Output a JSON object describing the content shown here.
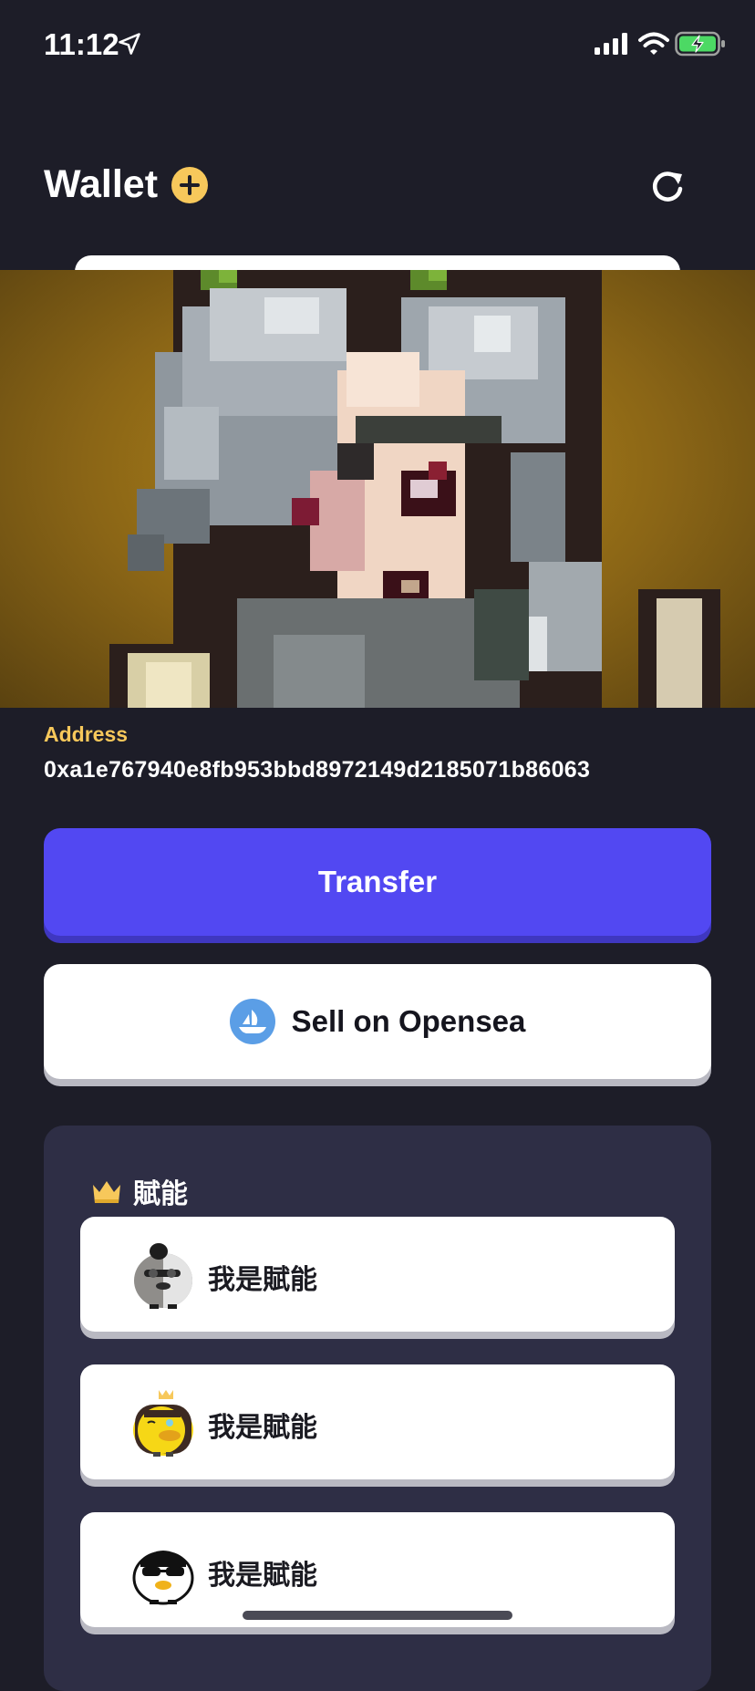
{
  "status_bar": {
    "time": "11:12",
    "icons": [
      "location-arrow-icon",
      "cellular-signal-icon",
      "wifi-icon",
      "battery-charging-icon"
    ]
  },
  "header": {
    "title": "Wallet",
    "add_icon": "plus-circle-icon",
    "refresh_icon": "refresh-icon"
  },
  "nft": {
    "image_desc": "pixel-art-character-silver-hair"
  },
  "address": {
    "label": "Address",
    "value": "0xa1e767940e8fb953bbd8972149d2185071b86063"
  },
  "actions": {
    "transfer_label": "Transfer",
    "opensea_label": "Sell on Opensea",
    "opensea_icon": "opensea-logo-icon"
  },
  "abilities": {
    "icon": "crown-icon",
    "title": "賦能",
    "items": [
      {
        "label": "我是賦能",
        "avatar": "duck-avatar-gray"
      },
      {
        "label": "我是賦能",
        "avatar": "duck-avatar-yellow-crown"
      },
      {
        "label": "我是賦能",
        "avatar": "duck-avatar-white-sunglasses"
      }
    ]
  },
  "colors": {
    "background": "#1d1d28",
    "accent_yellow": "#f7c85b",
    "transfer_purple": "#5248f2",
    "panel": "#2e2e45"
  }
}
